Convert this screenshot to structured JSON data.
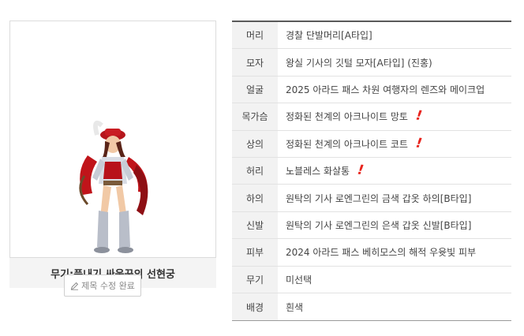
{
  "character": {
    "caption": "무기:풋내기 싸움꾼의 선현궁",
    "avatar_icon": "character-avatar"
  },
  "edit_button": {
    "label": "제목 수정 완료",
    "icon": "pencil-icon"
  },
  "equipment": [
    {
      "label": "머리",
      "value": "경찰 단발머리[A타입]",
      "marked": false
    },
    {
      "label": "모자",
      "value": "왕실 기사의 깃털 모자[A타입] (진홍)",
      "marked": false
    },
    {
      "label": "얼굴",
      "value": "2025 아라드 패스 차원 여행자의 렌즈와 메이크업",
      "marked": false
    },
    {
      "label": "목가슴",
      "value": "정화된 천계의 아크나이트 망토",
      "marked": true
    },
    {
      "label": "상의",
      "value": "정화된 천계의 아크나이트 코트",
      "marked": true
    },
    {
      "label": "허리",
      "value": "노블레스 화살통",
      "marked": true
    },
    {
      "label": "하의",
      "value": "원탁의 기사 로엔그린의 금색 갑옷 하의[B타입]",
      "marked": false
    },
    {
      "label": "신발",
      "value": "원탁의 기사 로엔그린의 은색 갑옷 신발[B타입]",
      "marked": false
    },
    {
      "label": "피부",
      "value": "2024 아라드 패스 베히모스의 해적 우윳빛 피부",
      "marked": false
    },
    {
      "label": "무기",
      "value": "미선택",
      "marked": false
    },
    {
      "label": "배경",
      "value": "흰색",
      "marked": false
    }
  ],
  "colors": {
    "mark": "#e8251e",
    "label_bg": "#f2f2f2",
    "caption_bg": "#f4f4f4"
  }
}
